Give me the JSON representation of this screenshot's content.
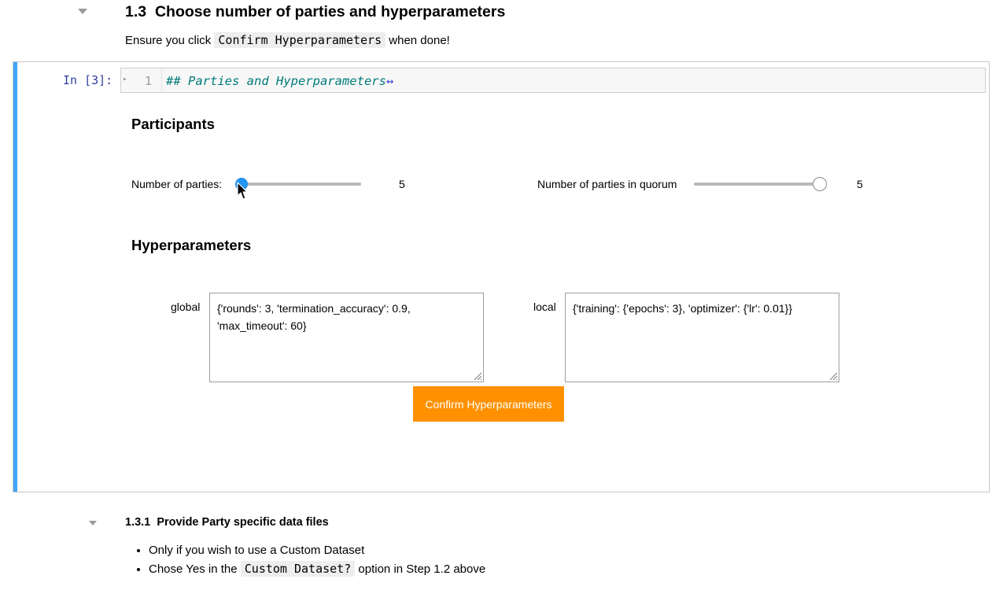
{
  "section": {
    "number": "1.3",
    "title": "Choose number of parties and hyperparameters",
    "note_before": "Ensure you click ",
    "note_code": "Confirm Hyperparameters",
    "note_after": " when done!"
  },
  "cell": {
    "prompt": "In [3]:",
    "fold_glyph": "▸",
    "line_number": "1",
    "code": "## Parties and Hyperparameters",
    "expand_glyph": "↔"
  },
  "participants": {
    "title": "Participants",
    "parties_label": "Number of parties:",
    "parties_value": "5",
    "quorum_label": "Number of parties in quorum",
    "quorum_value": "5"
  },
  "hyperparameters": {
    "title": "Hyperparameters",
    "global_label": "global",
    "global_value": "{'rounds': 3, 'termination_accuracy': 0.9, 'max_timeout': 60}",
    "local_label": "local",
    "local_value": "{'training': {'epochs': 3}, 'optimizer': {'lr': 0.01}}",
    "confirm_label": "Confirm Hyperparameters"
  },
  "subsection": {
    "number": "1.3.1",
    "title": "Provide Party specific data files",
    "item1": "Only if you wish to use a Custom Dataset",
    "item2_before": "Chose Yes in the ",
    "item2_code": "Custom Dataset?",
    "item2_after": " option in Step 1.2 above"
  },
  "colors": {
    "accent_bar": "#42a5f5",
    "slider_handle": "#2196f3",
    "button": "#ff9100",
    "prompt": "#303f9f",
    "code_comment": "#007979"
  },
  "icons": [
    "collapse-caret-icon",
    "fold-arrow-icon",
    "expand-arrows-icon",
    "mouse-cursor-icon",
    "resize-grip-icon"
  ]
}
